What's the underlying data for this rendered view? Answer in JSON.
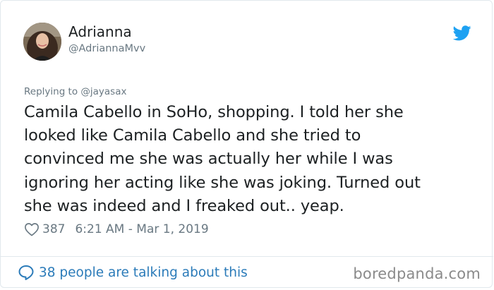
{
  "user": {
    "name": "Adrianna",
    "handle": "@AdriannaMvv"
  },
  "tweet": {
    "replying_to": "Replying to @jayasax",
    "text_lines": [
      "Camila Cabello in SoHo, shopping. I told her she",
      "looked like Camila Cabello and she tried to",
      "convinced me she was actually her while I was",
      "ignoring her acting like she was joking. Turned out",
      "she was indeed and I freaked out.. yeap."
    ],
    "likes": "387",
    "timestamp": "6:21 AM - Mar 1, 2019"
  },
  "footer": {
    "discussion": "38 people are talking about this"
  },
  "watermark": "boredpanda.com",
  "icons": {
    "brand": "twitter-bird-icon",
    "like": "heart-icon",
    "reply": "speech-bubble-icon"
  },
  "colors": {
    "twitter_blue": "#1da1f2",
    "link_blue": "#2b7bb9",
    "secondary_text": "#697882",
    "primary_text": "#1c2022",
    "border": "#e1e8ed"
  }
}
